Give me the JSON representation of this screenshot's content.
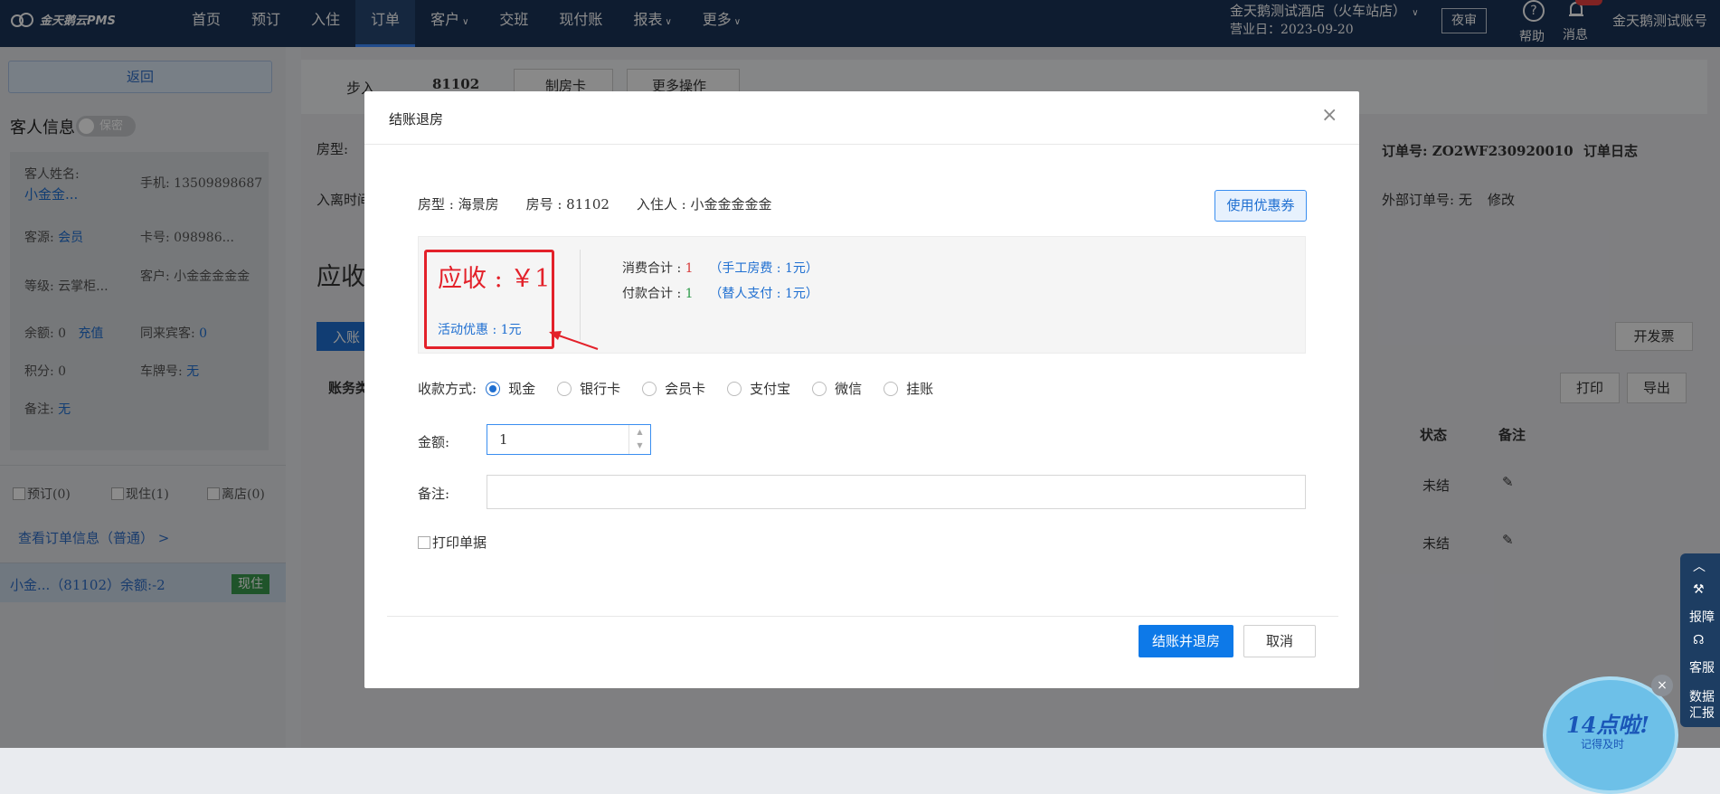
{
  "app": {
    "logo_text": "金天鹅云PMS"
  },
  "nav": {
    "items": [
      "首页",
      "预订",
      "入住",
      "订单",
      "客户",
      "交班",
      "现付账",
      "报表",
      "更多"
    ],
    "active": "订单"
  },
  "header": {
    "hotel": "金天鹅测试酒店（火车站店）",
    "business_day": "营业日：2023-09-20",
    "night_audit": "夜审",
    "help": "帮助",
    "messages": "消息",
    "account": "金天鹅测试账号"
  },
  "sidebar": {
    "back": "返回",
    "guest_info_title": "客人信息",
    "privacy_toggle": "保密",
    "guest_name_label": "客人姓名:",
    "guest_name": "小金金...",
    "phone": "手机: 13509898687",
    "source_label": "客源:",
    "source": "会员",
    "card": "卡号: 098986...",
    "level": "等级: 云掌柜...",
    "customer": "客户: 小金金金金金",
    "balance": "余额: 0",
    "recharge": "充值",
    "companions_label": "同来宾客:",
    "companions": "0",
    "points": "积分: 0",
    "plate_label": "车牌号:",
    "plate": "无",
    "remark_label": "备注:",
    "remark": "无",
    "filters": [
      "预订(0)",
      "现住(1)",
      "离店(0)"
    ],
    "view_order": "查看订单信息（普通） >",
    "room_entry": "小金...（81102）余额:-2",
    "room_status": "现住"
  },
  "background": {
    "step_in": "步入",
    "room_no": "81102",
    "make_card": "制房卡",
    "more_ops": "更多操作",
    "room_type_label": "房型:",
    "checkin_label": "入离时间",
    "order_no": "订单号: ZO2WF230920010",
    "order_log": "订单日志",
    "external_no": "外部订单号: 无",
    "modify": "修改",
    "receivable_partial": "应收",
    "post_btn": "入账",
    "account_type": "账务类",
    "invoice": "开发票",
    "print": "打印",
    "export": "导出",
    "col_status": "状态",
    "col_remark": "备注",
    "row_status": [
      "未结",
      "未结"
    ]
  },
  "modal": {
    "title": "结账退房",
    "room_type": "房型 : 海景房",
    "room_no": "房号 : 81102",
    "guest": "入住人 : 小金金金金金",
    "coupon_btn": "使用优惠券",
    "receivable": "应收 : ￥1",
    "discount": "活动优惠 : 1元",
    "consume_label": "消费合计 : ",
    "consume_value": "1",
    "consume_detail": "（手工房费 : 1元）",
    "payment_label": "付款合计 : ",
    "payment_value": "1",
    "payment_detail": "（替人支付 : 1元）",
    "payment_method_label": "收款方式:",
    "payment_methods": [
      "现金",
      "银行卡",
      "会员卡",
      "支付宝",
      "微信",
      "挂账"
    ],
    "selected_method": "现金",
    "amount_label": "金额:",
    "amount_value": "1",
    "remark_label": "备注:",
    "remark_value": "",
    "print_receipt": "打印单据",
    "confirm_btn": "结账并退房",
    "cancel_btn": "取消"
  },
  "right_tools": {
    "report_issue": "报障",
    "service": "客服",
    "data_report": "数据汇报"
  },
  "promo": {
    "headline": "14点啦!",
    "sub": "记得及时"
  },
  "colors": {
    "topbar": "#1b3358",
    "accent": "#0d79e8",
    "alert_red": "#e3212a"
  }
}
